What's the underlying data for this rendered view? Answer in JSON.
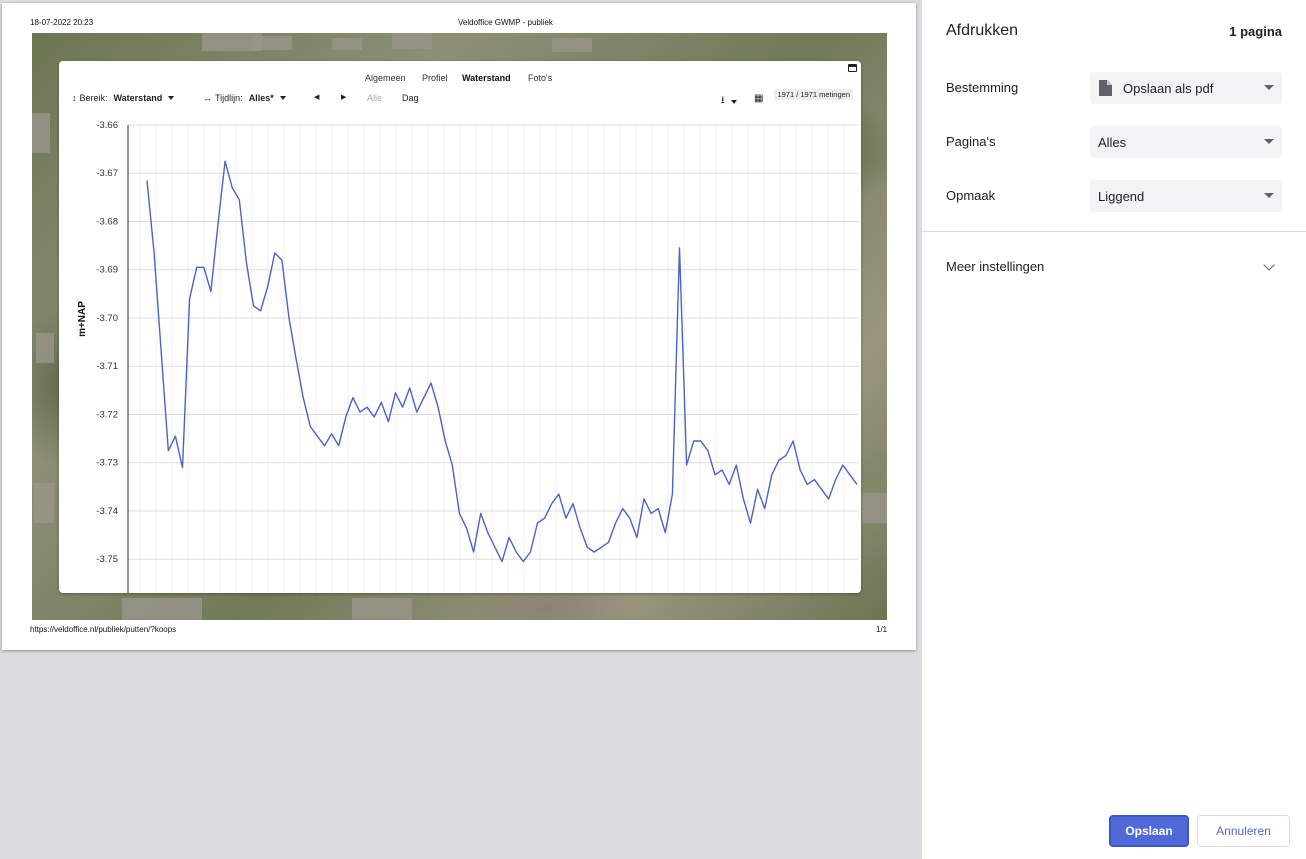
{
  "print_header": {
    "datetime": "18-07-2022 20:23",
    "title": "Veldoffice GWMP - publiek"
  },
  "print_footer": {
    "url": "https://veldoffice.nl/publiek/putten/?koops",
    "page": "1/1"
  },
  "app": {
    "tabs": [
      {
        "label": "Algemeen",
        "active": false
      },
      {
        "label": "Profiel",
        "active": false
      },
      {
        "label": "Waterstand",
        "active": true
      },
      {
        "label": "Foto's",
        "active": false
      }
    ],
    "toolbar": {
      "range_label": "Bereik:",
      "range_value": "Waterstand",
      "timeline_label": "Tijdlijn:",
      "timeline_value": "Alles*",
      "all_label": "Alle",
      "day_label": "Dag",
      "measurements": "1971 / 1971 metingen"
    }
  },
  "chart_data": {
    "type": "line",
    "title": "",
    "xlabel": "",
    "ylabel": "m+NAP",
    "ylim": [
      -3.757,
      -3.66
    ],
    "yticks": [
      "-3.66",
      "-3.67",
      "-3.68",
      "-3.69",
      "-3.70",
      "-3.71",
      "-3.72",
      "-3.73",
      "-3.74",
      "-3.75"
    ],
    "grid": true,
    "line_color": "#4a63c8",
    "x": [
      0,
      1,
      2,
      3,
      4,
      5,
      6,
      7,
      8,
      9,
      10,
      11,
      12,
      13,
      14,
      15,
      16,
      17,
      18,
      19,
      20,
      21,
      22,
      23,
      24,
      25,
      26,
      27,
      28,
      29,
      30,
      31,
      32,
      33,
      34,
      35,
      36,
      37,
      38,
      39,
      40,
      41,
      42,
      43,
      44,
      45,
      46,
      47,
      48,
      49,
      50,
      51,
      52,
      53,
      54,
      55,
      56,
      57,
      58,
      59,
      60,
      61,
      62,
      63,
      64,
      65,
      66,
      67,
      68,
      69,
      70,
      71,
      72,
      73,
      74,
      75,
      76,
      77,
      78,
      79,
      80,
      81,
      82,
      83,
      84,
      85,
      86,
      87,
      88,
      89,
      90,
      91,
      92,
      93,
      94,
      95,
      96,
      97,
      98,
      99,
      100
    ],
    "values": [
      -3.6715,
      -3.6865,
      -3.707,
      -3.7275,
      -3.7245,
      -3.731,
      -3.696,
      -3.6895,
      -3.6895,
      -3.6945,
      -3.6805,
      -3.6675,
      -3.673,
      -3.6755,
      -3.6885,
      -3.6975,
      -3.6985,
      -3.6935,
      -3.6865,
      -3.688,
      -3.7,
      -3.7085,
      -3.7165,
      -3.7225,
      -3.7245,
      -3.7265,
      -3.724,
      -3.7265,
      -3.7205,
      -3.7165,
      -3.7195,
      -3.7185,
      -3.7205,
      -3.7175,
      -3.7215,
      -3.7155,
      -3.7185,
      -3.7145,
      -3.7195,
      -3.7165,
      -3.7135,
      -3.7185,
      -3.7255,
      -3.7305,
      -3.7405,
      -3.7435,
      -3.7485,
      -3.7405,
      -3.7445,
      -3.7475,
      -3.7505,
      -3.7455,
      -3.7485,
      -3.7505,
      -3.7485,
      -3.7425,
      -3.7415,
      -3.7385,
      -3.7365,
      -3.7415,
      -3.7385,
      -3.7435,
      -3.7475,
      -3.7485,
      -3.7475,
      -3.7465,
      -3.7425,
      -3.7395,
      -3.7415,
      -3.7455,
      -3.7375,
      -3.7405,
      -3.7395,
      -3.7445,
      -3.7365,
      -3.6855,
      -3.7305,
      -3.7255,
      -3.7255,
      -3.7275,
      -3.7325,
      -3.7315,
      -3.7345,
      -3.7305,
      -3.7375,
      -3.7425,
      -3.7355,
      -3.7395,
      -3.7325,
      -3.7295,
      -3.7285,
      -3.7255,
      -3.7315,
      -3.7345,
      -3.7335,
      -3.7355,
      -3.7375,
      -3.7335,
      -3.7305,
      -3.7325,
      -3.7345
    ]
  },
  "panel": {
    "title": "Afdrukken",
    "page_count": "1 pagina",
    "destination_label": "Bestemming",
    "destination_value": "Opslaan als pdf",
    "pages_label": "Pagina's",
    "pages_value": "Alles",
    "layout_label": "Opmaak",
    "layout_value": "Liggend",
    "more_settings": "Meer instellingen",
    "save_button": "Opslaan",
    "cancel_button": "Annuleren"
  }
}
